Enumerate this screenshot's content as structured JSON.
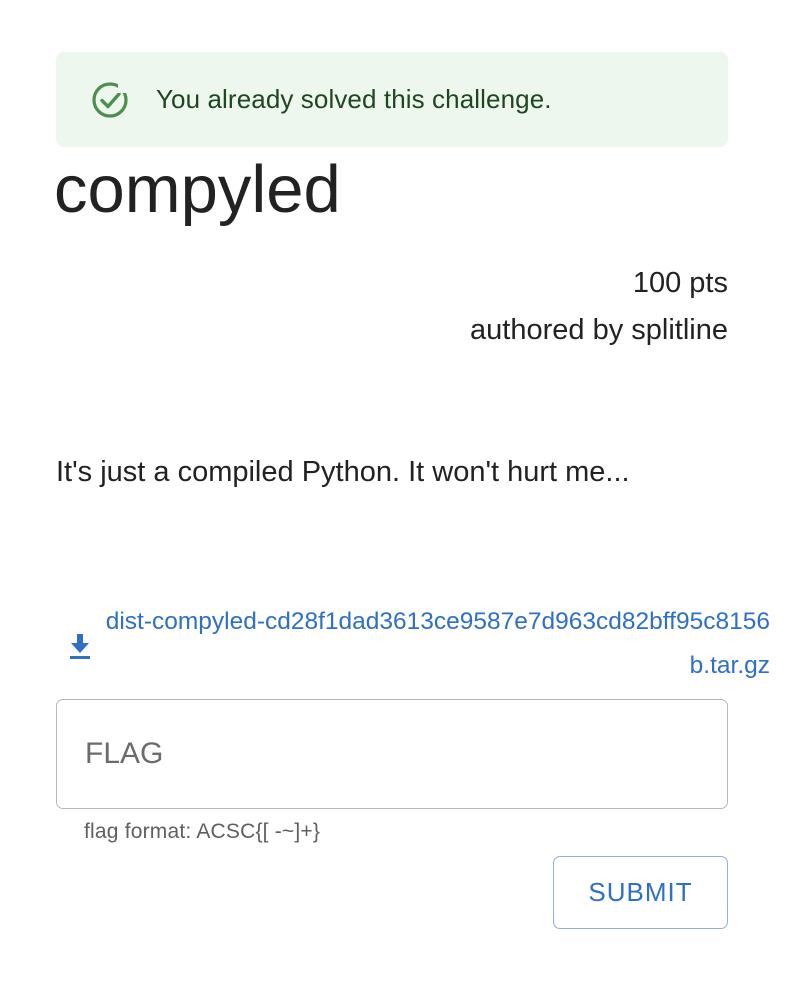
{
  "alert": {
    "icon": "check-circle-icon",
    "message": "You already solved this challenge.",
    "color": "#2e7d32"
  },
  "challenge": {
    "title": "compyled",
    "points": "100 pts",
    "author": "authored by splitline",
    "description": "It's just a compiled Python. It won't hurt me..."
  },
  "attachment": {
    "icon": "download-icon",
    "filename": "dist-compyled-cd28f1dad3613ce9587e7d963cd82bff95c8156b.tar.gz"
  },
  "flag_form": {
    "placeholder": "FLAG",
    "value": "",
    "helper": "flag format: ACSC{[ -~]+}",
    "submit_label": "SUBMIT",
    "accent": "#2f6fc4"
  }
}
